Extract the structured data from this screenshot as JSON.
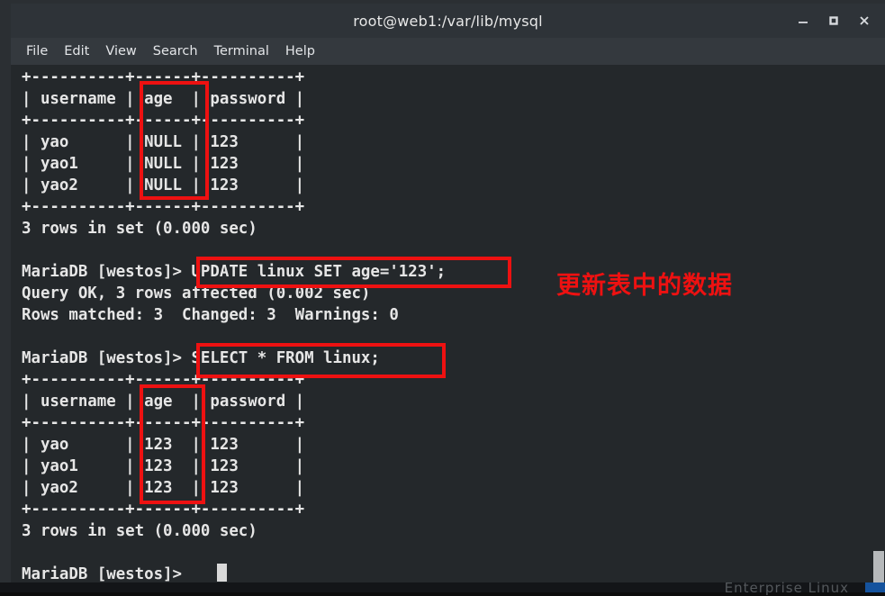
{
  "window": {
    "title": "root@web1:/var/lib/mysql",
    "controls": {
      "minimize": "minimize",
      "maximize": "maximize",
      "close": "close"
    }
  },
  "menubar": {
    "items": [
      {
        "label": "File"
      },
      {
        "label": "Edit"
      },
      {
        "label": "View"
      },
      {
        "label": "Search"
      },
      {
        "label": "Terminal"
      },
      {
        "label": "Help"
      }
    ]
  },
  "terminal": {
    "colors": {
      "background": "#24282b",
      "foreground": "#e6e6e6",
      "annotation": "#ee1111",
      "cursor": "#d9d9d9"
    },
    "prompt": "MariaDB [westos]> ",
    "content": "+----------+------+----------+\n| username | age  | password |\n+----------+------+----------+\n| yao      | NULL | 123      |\n| yao1     | NULL | 123      |\n| yao2     | NULL | 123      |\n+----------+------+----------+\n3 rows in set (0.000 sec)\n\nMariaDB [westos]> UPDATE linux SET age='123';\nQuery OK, 3 rows affected (0.002 sec)\nRows matched: 3  Changed: 3  Warnings: 0\n\nMariaDB [westos]> SELECT * FROM linux;\n+----------+------+----------+\n| username | age  | password |\n+----------+------+----------+\n| yao      | 123  | 123      |\n| yao1     | 123  | 123      |\n| yao2     | 123  | 123      |\n+----------+------+----------+\n3 rows in set (0.000 sec)\n\nMariaDB [westos]> ",
    "tables": [
      {
        "columns": [
          "username",
          "age",
          "password"
        ],
        "rows": [
          [
            "yao",
            "NULL",
            "123"
          ],
          [
            "yao1",
            "NULL",
            "123"
          ],
          [
            "yao2",
            "NULL",
            "123"
          ]
        ],
        "result_line": "3 rows in set (0.000 sec)"
      },
      {
        "columns": [
          "username",
          "age",
          "password"
        ],
        "rows": [
          [
            "yao",
            "123",
            "123"
          ],
          [
            "yao1",
            "123",
            "123"
          ],
          [
            "yao2",
            "123",
            "123"
          ]
        ],
        "result_line": "3 rows in set (0.000 sec)"
      }
    ],
    "commands": [
      {
        "text": "UPDATE linux SET age='123';",
        "highlighted": true
      },
      {
        "text": "SELECT * FROM linux;",
        "highlighted": true
      }
    ],
    "messages": [
      "Query OK, 3 rows affected (0.002 sec)",
      "Rows matched: 3  Changed: 3  Warnings: 0"
    ]
  },
  "annotations": {
    "note_cn": "更新表中的数据",
    "highlight_labels": {
      "age_column_before": "age-column-before-update",
      "update_command": "update-command",
      "select_command": "select-command",
      "age_column_after": "age-column-after-update"
    }
  },
  "watermark": {
    "text": "Enterprise Linux"
  }
}
